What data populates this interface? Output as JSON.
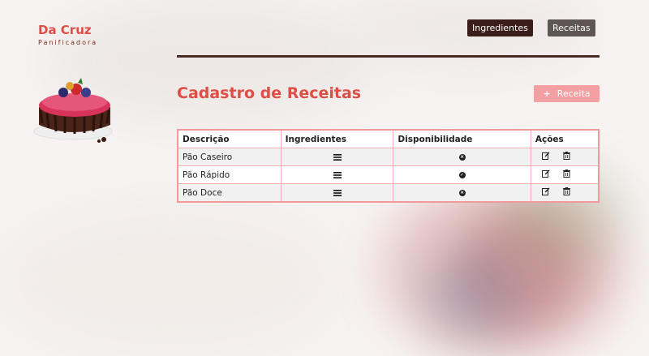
{
  "brand": {
    "name": "Da Cruz",
    "subtitle": "Panificadora"
  },
  "nav": {
    "ingredientes": "Ingredientes",
    "receitas": "Receitas"
  },
  "page": {
    "title": "Cadastro de Receitas",
    "add_button": "Receita"
  },
  "table": {
    "headers": [
      "Descrição",
      "Ingredientes",
      "Disponibilidade",
      "Ações"
    ],
    "rows": [
      {
        "descricao": "Pão Caseiro",
        "disponivel": false
      },
      {
        "descricao": "Pão Rápido",
        "disponivel": true
      },
      {
        "descricao": "Pão Doce",
        "disponivel": false
      }
    ]
  },
  "icons": {
    "ingredients": "list-icon",
    "available": "check-circle-icon",
    "unavailable": "x-circle-icon",
    "edit": "edit-icon",
    "delete": "trash-icon"
  },
  "colors": {
    "brand_red": "#dd4f46",
    "dark_brown": "#3b1e1a",
    "pink_button": "#f4a0a2",
    "table_border": "#f29a9a"
  }
}
